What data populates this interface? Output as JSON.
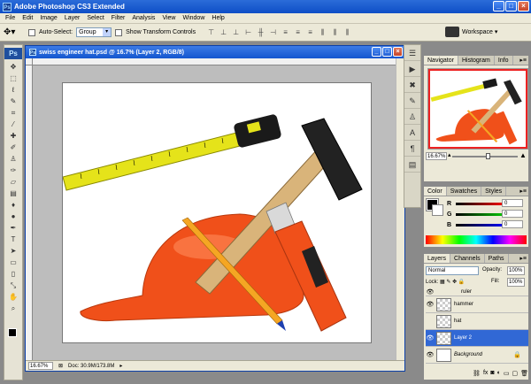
{
  "app": {
    "title": "Adobe Photoshop CS3 Extended",
    "icon_label": "Ps"
  },
  "window_controls": {
    "minimize": "_",
    "maximize": "□",
    "close": "×"
  },
  "menu": [
    "File",
    "Edit",
    "Image",
    "Layer",
    "Select",
    "Filter",
    "Analysis",
    "View",
    "Window",
    "Help"
  ],
  "options_bar": {
    "tool_icon": "move-tool-icon",
    "auto_select_label": "Auto-Select:",
    "auto_select_value": "Group",
    "show_transform_label": "Show Transform Controls",
    "workspace_label": "Workspace ▾"
  },
  "toolbox": {
    "logo": "Ps",
    "tools": [
      "move",
      "marquee",
      "lasso",
      "quick-select",
      "crop",
      "slice",
      "healing",
      "brush",
      "stamp",
      "history-brush",
      "eraser",
      "gradient",
      "blur",
      "dodge",
      "pen",
      "type",
      "path-select",
      "shape",
      "notes",
      "eyedropper",
      "hand",
      "zoom"
    ]
  },
  "document": {
    "title": "swiss engineer hat.psd @ 16.7% (Layer 2, RGB/8)",
    "status_zoom": "16.67%",
    "status_doc": "Doc: 30.9M/173.8M"
  },
  "navigator": {
    "tabs": [
      "Navigator",
      "Histogram",
      "Info"
    ],
    "zoom": "16.67%"
  },
  "color_panel": {
    "tabs": [
      "Color",
      "Swatches",
      "Styles"
    ],
    "channels": [
      {
        "label": "R",
        "value": "0",
        "color": "#d22"
      },
      {
        "label": "G",
        "value": "0",
        "color": "#2a2"
      },
      {
        "label": "B",
        "value": "0",
        "color": "#22d"
      }
    ]
  },
  "layers_panel": {
    "tabs": [
      "Layers",
      "Channels",
      "Paths"
    ],
    "blend_mode": "Normal",
    "opacity_label": "Opacity:",
    "opacity": "100%",
    "lock_label": "Lock:",
    "fill_label": "Fill:",
    "fill": "100%",
    "layers": [
      {
        "name": "ruler",
        "visible": true,
        "selected": false
      },
      {
        "name": "hammer",
        "visible": true,
        "selected": false
      },
      {
        "name": "hat",
        "visible": false,
        "selected": false
      },
      {
        "name": "Layer 2",
        "visible": true,
        "selected": true
      },
      {
        "name": "Background",
        "visible": true,
        "selected": false,
        "italic": true,
        "locked": true
      }
    ]
  },
  "colors": {
    "title_bar": "#0e4ec6",
    "hat": "#f0501a",
    "tape": "#e5e31a",
    "selection": "#3168d5"
  }
}
